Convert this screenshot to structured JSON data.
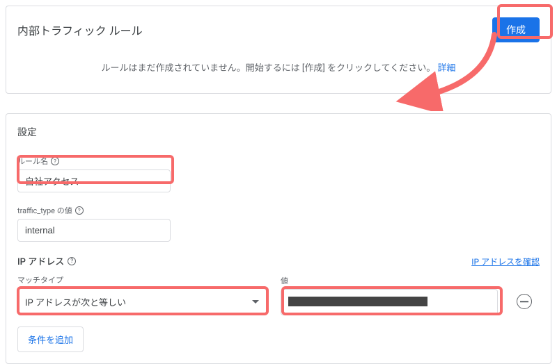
{
  "top_panel": {
    "title": "内部トラフィック ルール",
    "create_label": "作成",
    "empty_message": "ルールはまだ作成されていません。開始するには [作成] をクリックしてください。",
    "details_link": "詳細"
  },
  "settings": {
    "title": "設定",
    "rule_name": {
      "label": "ルール名",
      "value": "自社アクセス"
    },
    "traffic_type": {
      "label": "traffic_type の値",
      "value": "internal"
    },
    "ip_section": {
      "title": "IP アドレス",
      "check_link": "IP アドレスを確認",
      "match_type_label": "マッチタイプ",
      "match_type_value": "IP アドレスが次と等しい",
      "value_label": "値",
      "add_condition_label": "条件を追加"
    }
  },
  "colors": {
    "primary": "#1a73e8",
    "border": "#dadce0",
    "highlight": "#f76a6a"
  }
}
